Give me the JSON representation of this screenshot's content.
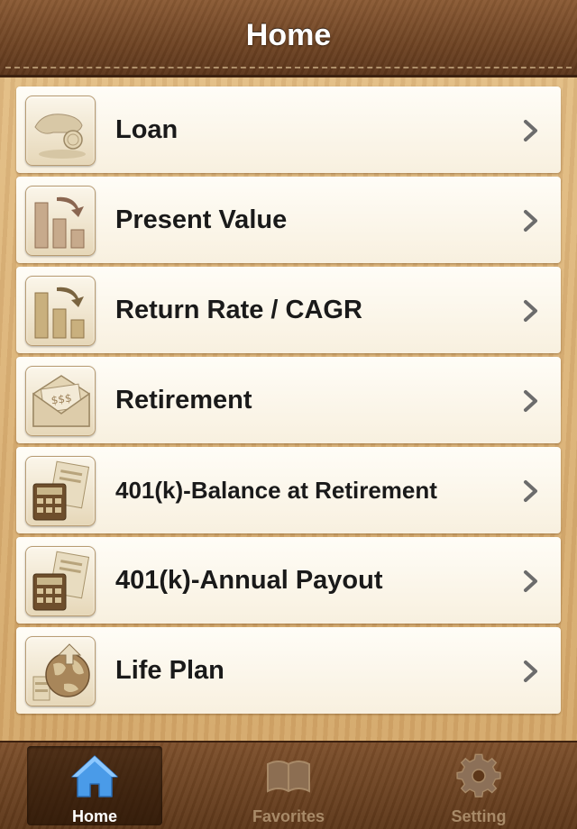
{
  "header": {
    "title": "Home"
  },
  "menu": {
    "items": [
      {
        "label": "Loan",
        "icon": "coin-hand-icon"
      },
      {
        "label": "Present Value",
        "icon": "bar-chart-down-icon"
      },
      {
        "label": "Return Rate / CAGR",
        "icon": "bar-chart-down-icon"
      },
      {
        "label": "Retirement",
        "icon": "money-envelope-icon"
      },
      {
        "label": "401(k)-Balance at Retirement",
        "icon": "calculator-icon"
      },
      {
        "label": "401(k)-Annual Payout",
        "icon": "calculator-icon"
      },
      {
        "label": "Life Plan",
        "icon": "globe-dollar-icon"
      }
    ]
  },
  "tabbar": {
    "tabs": [
      {
        "label": "Home",
        "icon": "house-icon",
        "active": true
      },
      {
        "label": "Favorites",
        "icon": "book-icon",
        "active": false
      },
      {
        "label": "Setting",
        "icon": "gear-icon",
        "active": false
      }
    ]
  },
  "colors": {
    "header_brown": "#6e4323",
    "wood": "#d9b27a",
    "row_bg": "#fffdf7",
    "active_tab_icon": "#4a9be8",
    "inactive_tab": "#a88a68"
  }
}
